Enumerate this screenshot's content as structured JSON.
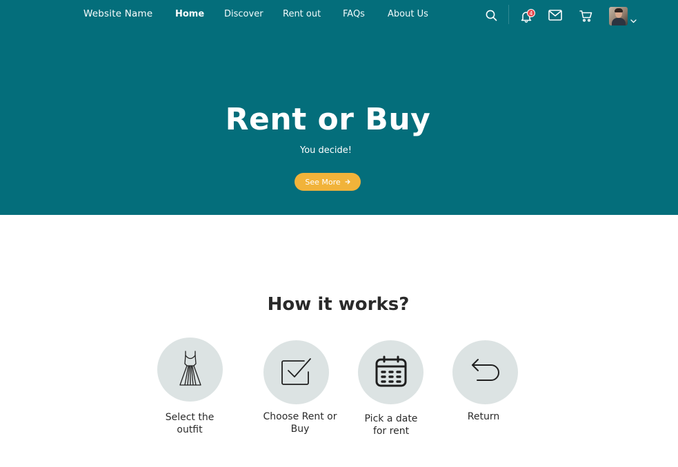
{
  "brand": {
    "name": "Website Name"
  },
  "nav": {
    "items": [
      {
        "label": "Home",
        "active": true
      },
      {
        "label": "Discover",
        "active": false
      },
      {
        "label": "Rent out",
        "active": false
      },
      {
        "label": "FAQs",
        "active": false
      },
      {
        "label": "About Us",
        "active": false
      }
    ]
  },
  "header_actions": {
    "icons": [
      "search-icon",
      "bell-icon",
      "mail-icon",
      "cart-icon",
      "chevron-down-icon"
    ],
    "notifications_count": "4"
  },
  "hero": {
    "title": "Rent or Buy",
    "subtitle": "You decide!",
    "cta_label": "See More",
    "background_color": "#046e7b",
    "cta_color": "#f1b33a"
  },
  "how_it_works": {
    "title": "How it works?",
    "steps": [
      {
        "label_line1": "Select the",
        "label_line2": "outfit",
        "icon": "dress-icon"
      },
      {
        "label_line1": "Choose Rent or",
        "label_line2": "Buy",
        "icon": "checkbox-icon"
      },
      {
        "label_line1": "Pick a date",
        "label_line2": "for rent",
        "icon": "calendar-icon"
      },
      {
        "label_line1": "Return",
        "label_line2": "",
        "icon": "return-arrow-icon"
      }
    ]
  },
  "colors": {
    "notification_badge": "#e5484d",
    "step_circle": "#dce3e3"
  }
}
